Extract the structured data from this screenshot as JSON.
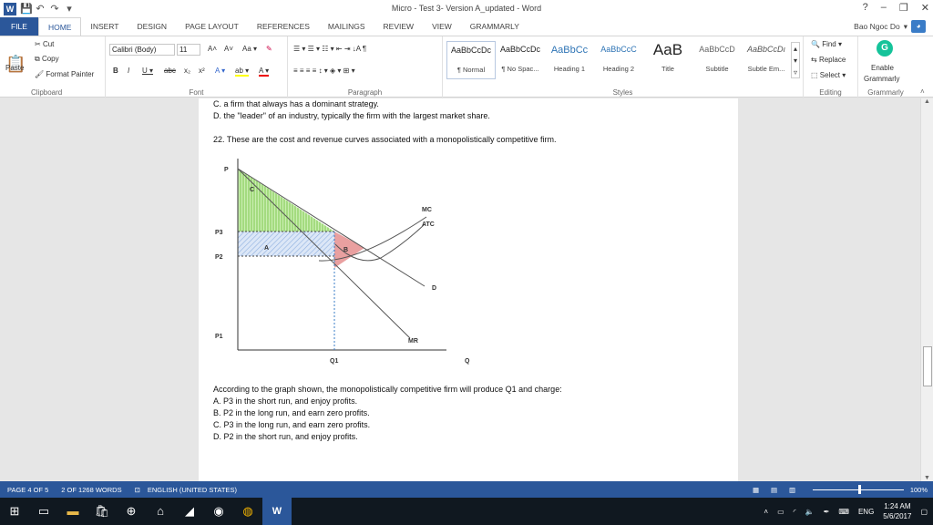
{
  "window": {
    "title": "Micro - Test 3- Version A_updated - Word",
    "help": "?",
    "min": "–",
    "max": "❐",
    "close": "✕"
  },
  "qat": {
    "word_icon": "W",
    "save": "💾",
    "undo": "↶",
    "redo": "↷",
    "customize": "▾"
  },
  "tabs": [
    "FILE",
    "HOME",
    "INSERT",
    "DESIGN",
    "PAGE LAYOUT",
    "REFERENCES",
    "MAILINGS",
    "REVIEW",
    "VIEW",
    "GRAMMARLY"
  ],
  "user": {
    "name": "Bao Ngoc Do",
    "caret": "▾"
  },
  "clipboard": {
    "paste": "Paste",
    "cut": "Cut",
    "copy": "Copy",
    "format_painter": "Format Painter",
    "label": "Clipboard"
  },
  "font": {
    "family": "Calibri (Body)",
    "size": "11",
    "label": "Font",
    "grow": "A˄",
    "shrink": "A˅",
    "case": "Aa ▾",
    "clear": "✎",
    "bold": "B",
    "italic": "I",
    "underline": "U ▾",
    "strike": "abc",
    "sub": "x₂",
    "sup": "x²",
    "effects": "A ▾",
    "highlight": "ab ▾",
    "color": "A ▾"
  },
  "paragraph": {
    "label": "Paragraph",
    "row1": "☰ ▾  ☰ ▾  ☷ ▾   ⇤  ⇥   ↓A   ¶",
    "row2": "≡  ≡  ≡  ≡   ↕ ▾   ◈ ▾  ⊞ ▾"
  },
  "styles": {
    "label": "Styles",
    "items": [
      {
        "preview": "AaBbCcDc",
        "name": "¶ Normal"
      },
      {
        "preview": "AaBbCcDc",
        "name": "¶ No Spac..."
      },
      {
        "preview": "AaBbCc",
        "name": "Heading 1"
      },
      {
        "preview": "AaBbCcC",
        "name": "Heading 2"
      },
      {
        "preview": "AaB",
        "name": "Title"
      },
      {
        "preview": "AaBbCcD",
        "name": "Subtitle"
      },
      {
        "preview": "AaBbCcDı",
        "name": "Subtle Em..."
      }
    ]
  },
  "editing": {
    "label": "Editing",
    "find": "Find ▾",
    "replace": "Replace",
    "select": "Select ▾"
  },
  "grammarly": {
    "label": "Grammarly",
    "enable": "Enable",
    "name": "Grammarly",
    "icon": "G"
  },
  "document": {
    "line_c": "C. a firm that always has a dominant strategy.",
    "line_d": "D. the \"leader\" of an industry, typically the firm with the largest market share.",
    "q22": "22. These are the cost and revenue curves associated with a monopolistically competitive firm.",
    "question": "According to the graph shown, the monopolistically competitive firm will produce Q1 and charge:",
    "answers": [
      "A. P3 in the short run, and enjoy profits.",
      "B. P2 in the long run, and earn zero profits.",
      "C. P3 in the long run, and earn zero profits.",
      "D. P2 in the short run, and enjoy profits."
    ]
  },
  "graph": {
    "p": "P",
    "q": "Q",
    "p3": "P3",
    "p2": "P2",
    "p1": "P1",
    "q1": "Q1",
    "c": "C",
    "a": "A",
    "b": "B",
    "mc": "MC",
    "atc": "ATC",
    "d": "D",
    "mr": "MR",
    "colors": {
      "green": "#7ec850",
      "blue": "#8fb0e0",
      "red": "#e57373"
    }
  },
  "status": {
    "page": "PAGE 4 OF 5",
    "words": "2 OF 1268 WORDS",
    "lang": "ENGLISH (UNITED STATES)",
    "zoom": "100%"
  },
  "taskbar": {
    "time": "1:24 AM",
    "date": "5/6/2017",
    "lang": "ENG"
  }
}
